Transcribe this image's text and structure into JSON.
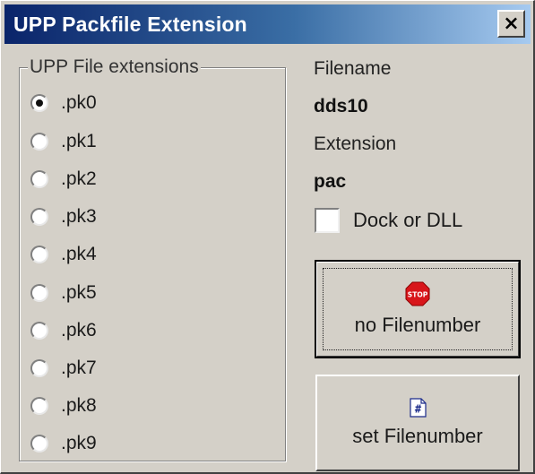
{
  "window": {
    "title": "UPP Packfile Extension",
    "close_glyph": "×"
  },
  "group": {
    "legend": "UPP File extensions",
    "options": [
      {
        "label": ".pk0",
        "selected": true
      },
      {
        "label": ".pk1",
        "selected": false
      },
      {
        "label": ".pk2",
        "selected": false
      },
      {
        "label": ".pk3",
        "selected": false
      },
      {
        "label": ".pk4",
        "selected": false
      },
      {
        "label": ".pk5",
        "selected": false
      },
      {
        "label": ".pk6",
        "selected": false
      },
      {
        "label": ".pk7",
        "selected": false
      },
      {
        "label": ".pk8",
        "selected": false
      },
      {
        "label": ".pk9",
        "selected": false
      }
    ]
  },
  "info": {
    "filename_label": "Filename",
    "filename_value": "dds10",
    "extension_label": "Extension",
    "extension_value": "pac"
  },
  "checkbox": {
    "label": "Dock or DLL",
    "checked": false
  },
  "buttons": {
    "no_filenumber": {
      "label": "no Filenumber",
      "icon": "stop-icon",
      "icon_text": "STOP"
    },
    "set_filenumber": {
      "label": "set Filenumber",
      "icon": "hash-icon",
      "icon_text": "#"
    }
  },
  "colors": {
    "title_gradient_start": "#0a246a",
    "title_gradient_end": "#a6caf0",
    "face": "#d4d0c8",
    "stop_red": "#d8161b"
  }
}
